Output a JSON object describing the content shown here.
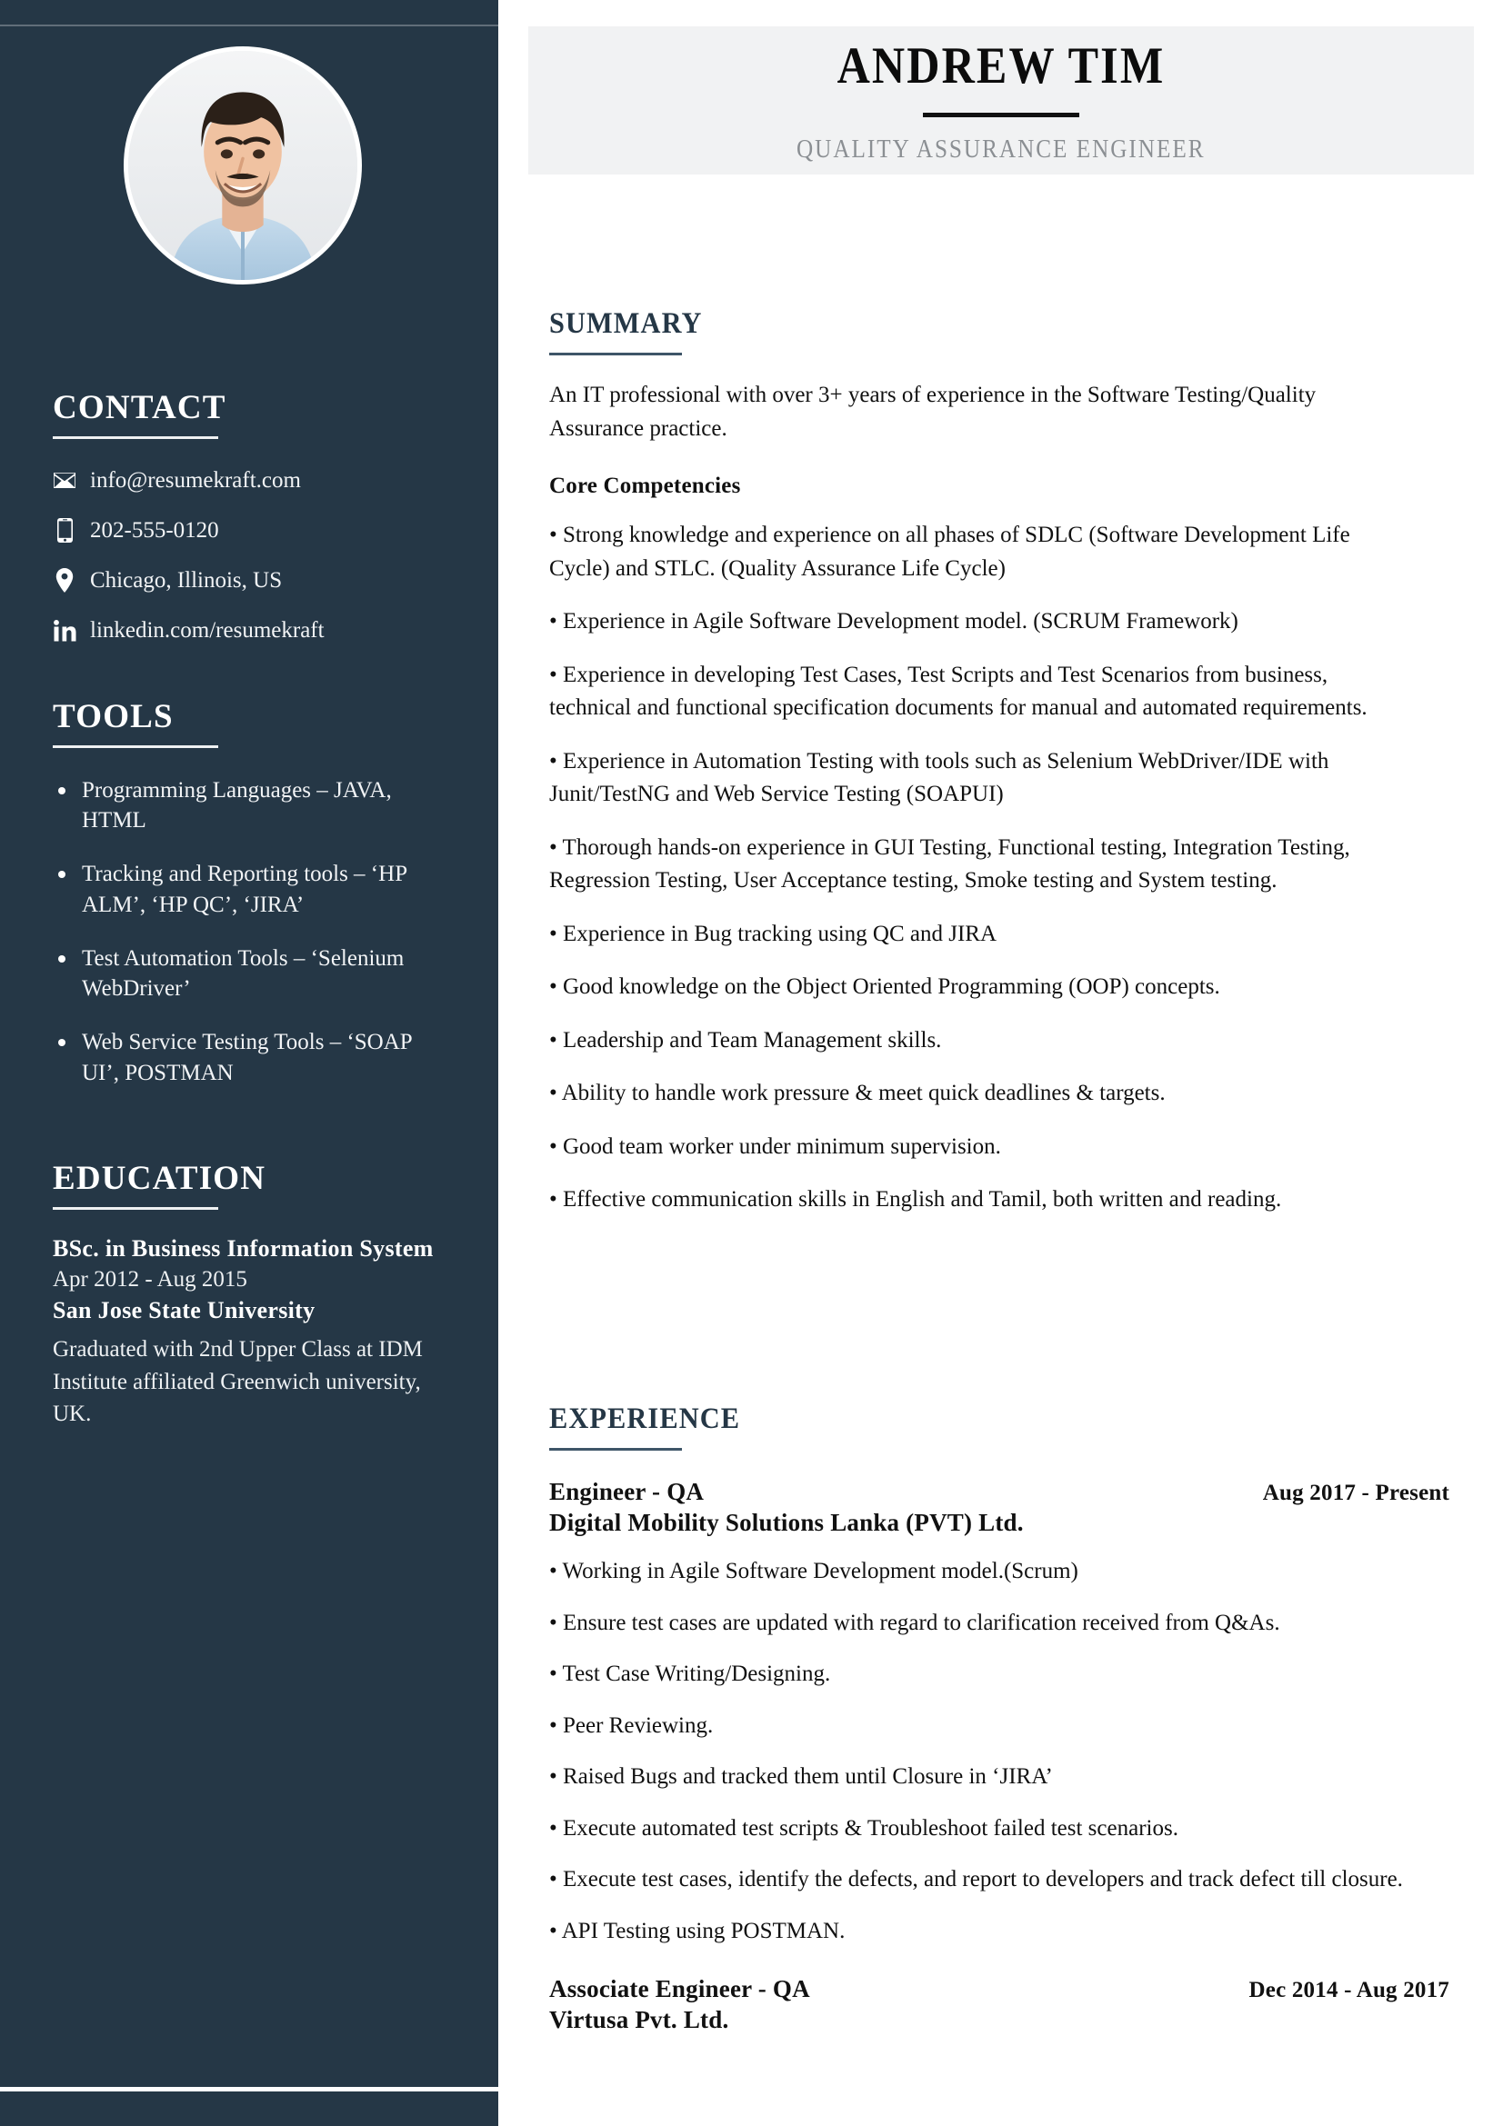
{
  "theme": {
    "sidebar_bg": "#253746",
    "accent": "#3e5568",
    "header_bg": "#f1f2f3",
    "text": "#111111",
    "muted": "#8b8f93"
  },
  "header": {
    "name": "ANDREW TIM",
    "job_title": "QUALITY ASSURANCE ENGINEER"
  },
  "sidebar": {
    "avatar_alt": "profile-photo",
    "contact": {
      "heading": "CONTACT",
      "items": [
        {
          "icon": "envelope-icon",
          "label": "info@resumekraft.com"
        },
        {
          "icon": "mobile-phone-icon",
          "label": "202-555-0120"
        },
        {
          "icon": "location-pin-icon",
          "label": "Chicago, Illinois, US"
        },
        {
          "icon": "linkedin-icon",
          "label": "linkedin.com/resumekraft"
        }
      ]
    },
    "tools": {
      "heading": "TOOLS",
      "items": [
        "Programming Languages – JAVA, HTML",
        "Tracking and Reporting tools – ‘HP ALM’, ‘HP QC’, ‘JIRA’",
        "Test Automation Tools – ‘Selenium WebDriver’",
        "Web Service Testing Tools – ‘SOAP UI’, POSTMAN"
      ]
    },
    "education": {
      "heading": "EDUCATION",
      "degree": "BSc. in Business Information System",
      "dates": "Apr 2012 - Aug 2015",
      "school": "San Jose State University",
      "description": "Graduated with 2nd Upper Class at IDM Institute affiliated Greenwich university, UK."
    }
  },
  "main": {
    "summary": {
      "heading": "SUMMARY",
      "paragraph": "An IT professional with over 3+ years of experience in the Software Testing/Quality Assurance practice.",
      "competencies_heading": "Core Competencies",
      "bullets": [
        "• Strong knowledge and experience on all phases of SDLC (Software Development Life Cycle) and STLC. (Quality Assurance Life Cycle)",
        "• Experience in Agile Software Development model. (SCRUM Framework)",
        "• Experience in developing Test Cases, Test Scripts and Test Scenarios from business, technical and functional specification documents for manual and automated requirements.",
        "• Experience in Automation Testing with tools such as Selenium WebDriver/IDE with Junit/TestNG and Web Service Testing (SOAPUI)",
        "• Thorough hands-on experience in GUI Testing, Functional testing, Integration Testing, Regression Testing, User Acceptance testing, Smoke testing and System testing.",
        "• Experience in Bug tracking using QC and JIRA",
        "• Good knowledge on the Object Oriented Programming (OOP) concepts.",
        "• Leadership and Team Management skills.",
        "• Ability to handle work pressure & meet quick deadlines & targets.",
        "• Good team worker under minimum supervision.",
        "• Effective communication skills in English and Tamil, both written and reading."
      ]
    },
    "experience": {
      "heading": "EXPERIENCE",
      "jobs": [
        {
          "role": "Engineer - QA",
          "date": "Aug 2017 - Present",
          "company": "Digital Mobility Solutions Lanka (PVT) Ltd.",
          "bullets": [
            "• Working in Agile Software Development model.(Scrum)",
            "• Ensure test cases are updated with regard to clarification received from Q&As.",
            "• Test Case Writing/Designing.",
            "• Peer Reviewing.",
            "• Raised Bugs and tracked them until Closure in ‘JIRA’",
            "• Execute automated test scripts & Troubleshoot failed test scenarios.",
            "• Execute test cases, identify the defects, and report to developers and track defect till closure.",
            "• API Testing using POSTMAN."
          ]
        },
        {
          "role": "Associate Engineer - QA",
          "date": "Dec 2014 - Aug 2017",
          "company": "Virtusa Pvt. Ltd.",
          "bullets": []
        }
      ]
    }
  }
}
